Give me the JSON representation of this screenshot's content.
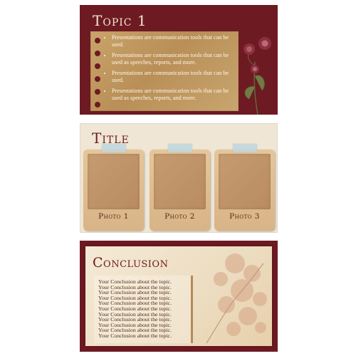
{
  "slide1": {
    "title": "Topic 1",
    "bullets": [
      "Presentations are communication tools that can be used.",
      "Presentations are communication tools that can be used as speeches, reports, and more.",
      "Presentations are communication tools that can be used.",
      "Presentations are communication tools that can be used as speeches, reports, and more."
    ]
  },
  "slide2": {
    "title": "Title",
    "photos": [
      "Photo 1",
      "Photo 2",
      "Photo 3"
    ]
  },
  "slide3": {
    "title": "Conclusion",
    "lines": [
      "Your Conclusion about the topic.",
      "Your Conclusion about the topic.",
      "Your Conclusion about the topic.",
      "Your Conclusion about the topic.",
      "Your Conclusion about the topic.",
      "Your Conclusion about the topic.",
      "Your Conclusion about the topic.",
      "Your Conclusion about the topic.",
      "Your Conclusion about the topic.",
      "Your Conclusion about the topic.",
      "Your Conclusion about the topic."
    ]
  },
  "colors": {
    "maroon": "#6e1a22",
    "parchment": "#c9a46a",
    "cream": "#efe6d6",
    "tape": "#bed6de"
  }
}
